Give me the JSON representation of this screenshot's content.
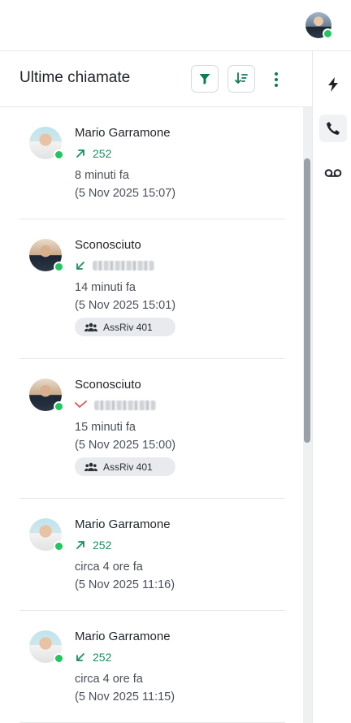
{
  "header": {
    "avatar": "user-avatar",
    "avatar_status_color": "#22c55e"
  },
  "panel": {
    "title": "Ultime chiamate",
    "filter_icon": "filter-icon",
    "sort_icon": "sort-descending-icon",
    "menu_icon": "more-vertical-icon"
  },
  "rail": {
    "items": [
      {
        "icon": "lightning-icon",
        "active": false
      },
      {
        "icon": "phone-icon",
        "active": true
      },
      {
        "icon": "voicemail-icon",
        "active": false
      }
    ]
  },
  "calls": [
    {
      "name": "Mario Garramone",
      "direction": "outgoing",
      "number": "252",
      "relative_time": "8 minuti fa",
      "datetime": "(5 Nov 2025 15:07)",
      "tag": ""
    },
    {
      "name": "Sconosciuto",
      "direction": "incoming",
      "number": "",
      "relative_time": "14 minuti fa",
      "datetime": "(5 Nov 2025 15:01)",
      "tag": "AssRiv 401"
    },
    {
      "name": "Sconosciuto",
      "direction": "missed",
      "number": "",
      "relative_time": "15 minuti fa",
      "datetime": "(5 Nov 2025 15:00)",
      "tag": "AssRiv 401"
    },
    {
      "name": "Mario Garramone",
      "direction": "outgoing",
      "number": "252",
      "relative_time": "circa 4 ore fa",
      "datetime": "(5 Nov 2025 11:16)",
      "tag": ""
    },
    {
      "name": "Mario Garramone",
      "direction": "incoming",
      "number": "252",
      "relative_time": "circa 4 ore fa",
      "datetime": "(5 Nov 2025 11:15)",
      "tag": ""
    }
  ],
  "colors": {
    "accent": "#0e7a55",
    "number": "#1b8e5f",
    "missed": "#e05252",
    "online": "#22c55e"
  }
}
